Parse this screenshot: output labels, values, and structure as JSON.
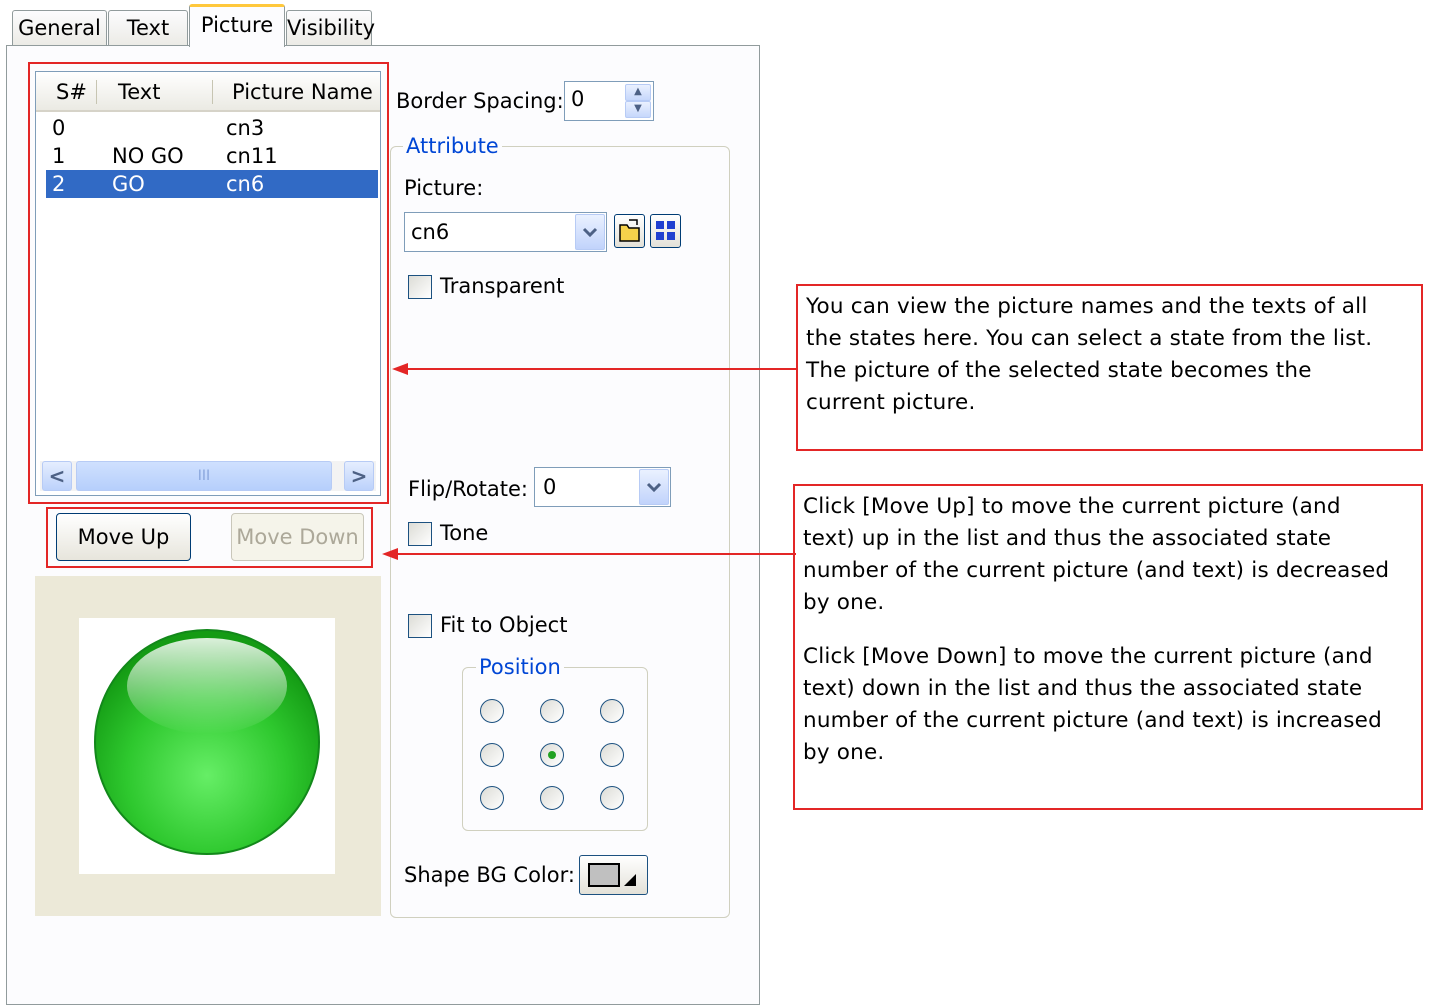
{
  "tabs": [
    "General",
    "Text",
    "Picture",
    "Visibility"
  ],
  "list": {
    "columns": [
      "S#",
      "Text",
      "Picture Name"
    ],
    "rows": [
      {
        "num": "0",
        "text": "",
        "picture": "cn3"
      },
      {
        "num": "1",
        "text": "NO GO",
        "picture": "cn11"
      },
      {
        "num": "2",
        "text": "GO",
        "picture": "cn6"
      }
    ],
    "selected_row": 2,
    "scroll_left": "<",
    "scroll_grip": "III",
    "scroll_right": ">"
  },
  "buttons": {
    "move_up": "Move Up",
    "move_down": "Move Down"
  },
  "border_spacing": {
    "label": "Border Spacing:",
    "value": "0"
  },
  "attribute": {
    "title": "Attribute",
    "picture_label": "Picture:",
    "picture_value": "cn6",
    "transparent_label": "Transparent",
    "flip_rotate_label": "Flip/Rotate:",
    "flip_rotate_value": "0",
    "tone_label": "Tone",
    "fit_label": "Fit to Object",
    "position_title": "Position",
    "position_selected": 4,
    "shape_bg_label": "Shape BG Color:"
  },
  "colors": {
    "selection": "#316ac5",
    "callout_border": "#e32626",
    "group_title": "#0046d5",
    "preview_ball": "#2ec82e"
  },
  "callouts": {
    "list_note": [
      "You can view the picture names and the texts of all",
      "the states here. You can select a state from the list.",
      "The picture of the selected state becomes the",
      "current picture."
    ],
    "move_up_note": [
      "Click [Move Up] to move the current picture (and",
      "text) up in the list and thus the associated state",
      "number of the current picture (and text) is decreased",
      "by one."
    ],
    "move_down_note": [
      "Click [Move Down] to move the current picture (and",
      "text) down in the list and thus the associated state",
      "number of the current picture (and text) is increased",
      "by one."
    ]
  }
}
